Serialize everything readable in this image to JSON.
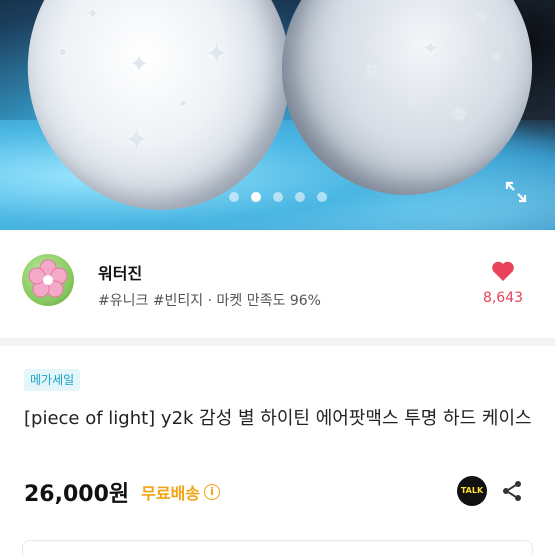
{
  "hero": {
    "slide_count": 5,
    "active_slide": 2
  },
  "seller": {
    "name": "워터진",
    "tags": "#유니크 #빈티지 · 마켓 만족도 96%",
    "likes": "8,643"
  },
  "product": {
    "badge": "메가세일",
    "title": "[piece of light] y2k 감성 별 하이틴 에어팟맥스 투명 하드 케이스",
    "price": "26,000원",
    "shipping": "무료배송",
    "talk_label": "TALK"
  },
  "colors": {
    "accent_like": "#e8435a",
    "shipping": "#f2a312",
    "badge_text": "#1aa3c7"
  },
  "icons": [
    "expand-icon",
    "heart-icon",
    "info-icon",
    "kakaotalk-icon",
    "share-icon"
  ]
}
